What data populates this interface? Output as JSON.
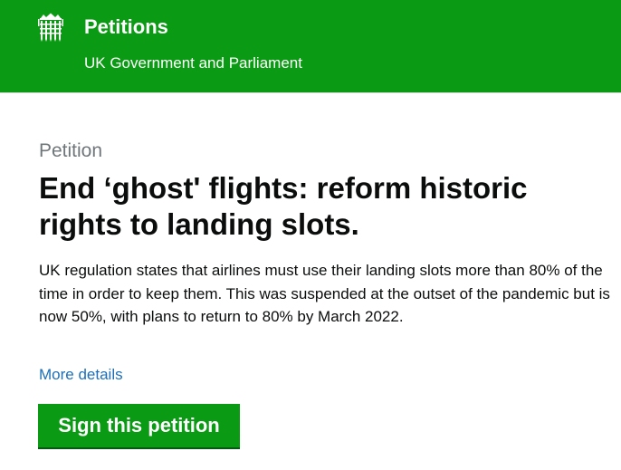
{
  "header": {
    "logo_icon": "portcullis-icon",
    "title": "Petitions",
    "subtitle": "UK Government and Parliament",
    "background_color": "#0b9a13"
  },
  "petition": {
    "caption": "Petition",
    "title": "End ‘ghost' flights: reform historic rights to landing slots.",
    "summary": "UK regulation states that airlines must use their landing slots more than 80% of the time in order to keep them. This was suspended at the outset of the pandemic but is now 50%, with plans to return to 80% by March 2022.",
    "more_details_label": "More details",
    "sign_button_label": "Sign this petition"
  },
  "colors": {
    "brand_green": "#0b9a13",
    "link_blue": "#1d70b8",
    "caption_grey": "#6f777b"
  }
}
